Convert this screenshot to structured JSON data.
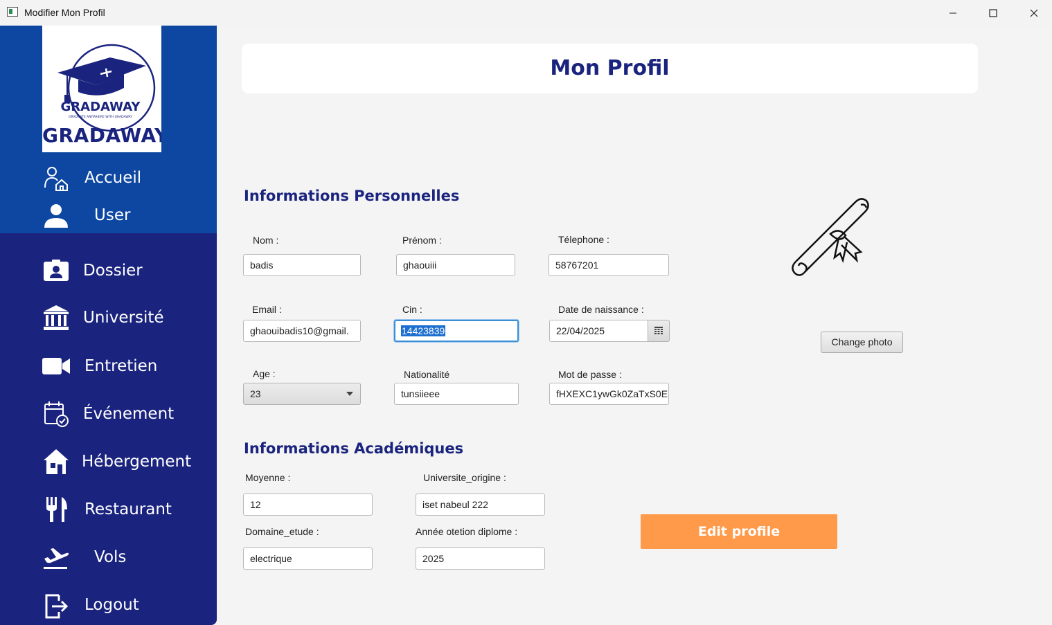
{
  "window": {
    "title": "Modifier Mon Profil"
  },
  "sidebar": {
    "logo_text": "GRADAWAY",
    "logo_inner": "GRADAWAY",
    "logo_tagline": "GRADUATE ANYWHERE WITH GRADAWAY",
    "items": [
      {
        "label": "Accueil",
        "icon": "home-user-icon"
      },
      {
        "label": "User",
        "icon": "user-icon"
      },
      {
        "label": "Dossier",
        "icon": "id-card-icon"
      },
      {
        "label": "Université",
        "icon": "university-icon"
      },
      {
        "label": "Entretien",
        "icon": "video-camera-icon"
      },
      {
        "label": "Événement",
        "icon": "calendar-check-icon"
      },
      {
        "label": "Hébergement",
        "icon": "house-icon"
      },
      {
        "label": "Restaurant",
        "icon": "fork-knife-icon"
      },
      {
        "label": "Vols",
        "icon": "plane-departure-icon"
      },
      {
        "label": "Logout",
        "icon": "logout-icon"
      }
    ]
  },
  "main": {
    "page_title": "Mon Profil",
    "personal": {
      "title": "Informations Personnelles",
      "nom": {
        "label": "Nom :",
        "value": "badis"
      },
      "prenom": {
        "label": "Prénom :",
        "value": "ghaouiii"
      },
      "telephone": {
        "label": "Télephone :",
        "value": "58767201"
      },
      "email": {
        "label": "Email :",
        "value": "ghaouibadis10@gmail."
      },
      "cin": {
        "label": "Cin :",
        "value": "14423839"
      },
      "date_naissance": {
        "label": "Date de naissance  :",
        "value": "22/04/2025"
      },
      "age": {
        "label": "Age :",
        "value": "23"
      },
      "nationalite": {
        "label": "Nationalité",
        "value": "tunsiieee"
      },
      "mot_de_passe": {
        "label": "Mot de passe :",
        "value": "fHXEXC1ywGk0ZaTxS0E"
      }
    },
    "academic": {
      "title": "Informations Académiques",
      "moyenne": {
        "label": "Moyenne :",
        "value": "12"
      },
      "universite_origine": {
        "label": "Universite_origine :",
        "value": "iset nabeul 222"
      },
      "domaine_etude": {
        "label": "Domaine_etude :",
        "value": "electrique"
      },
      "annee_diplome": {
        "label": "Année otetion diplome :",
        "value": "2025"
      }
    },
    "change_photo_label": "Change photo",
    "edit_profile_label": "Edit profile"
  },
  "colors": {
    "sidebar": "#1a237e",
    "sidebar_top": "#0d47a1",
    "title": "#1a237e",
    "edit_button": "#ff9a4a"
  }
}
